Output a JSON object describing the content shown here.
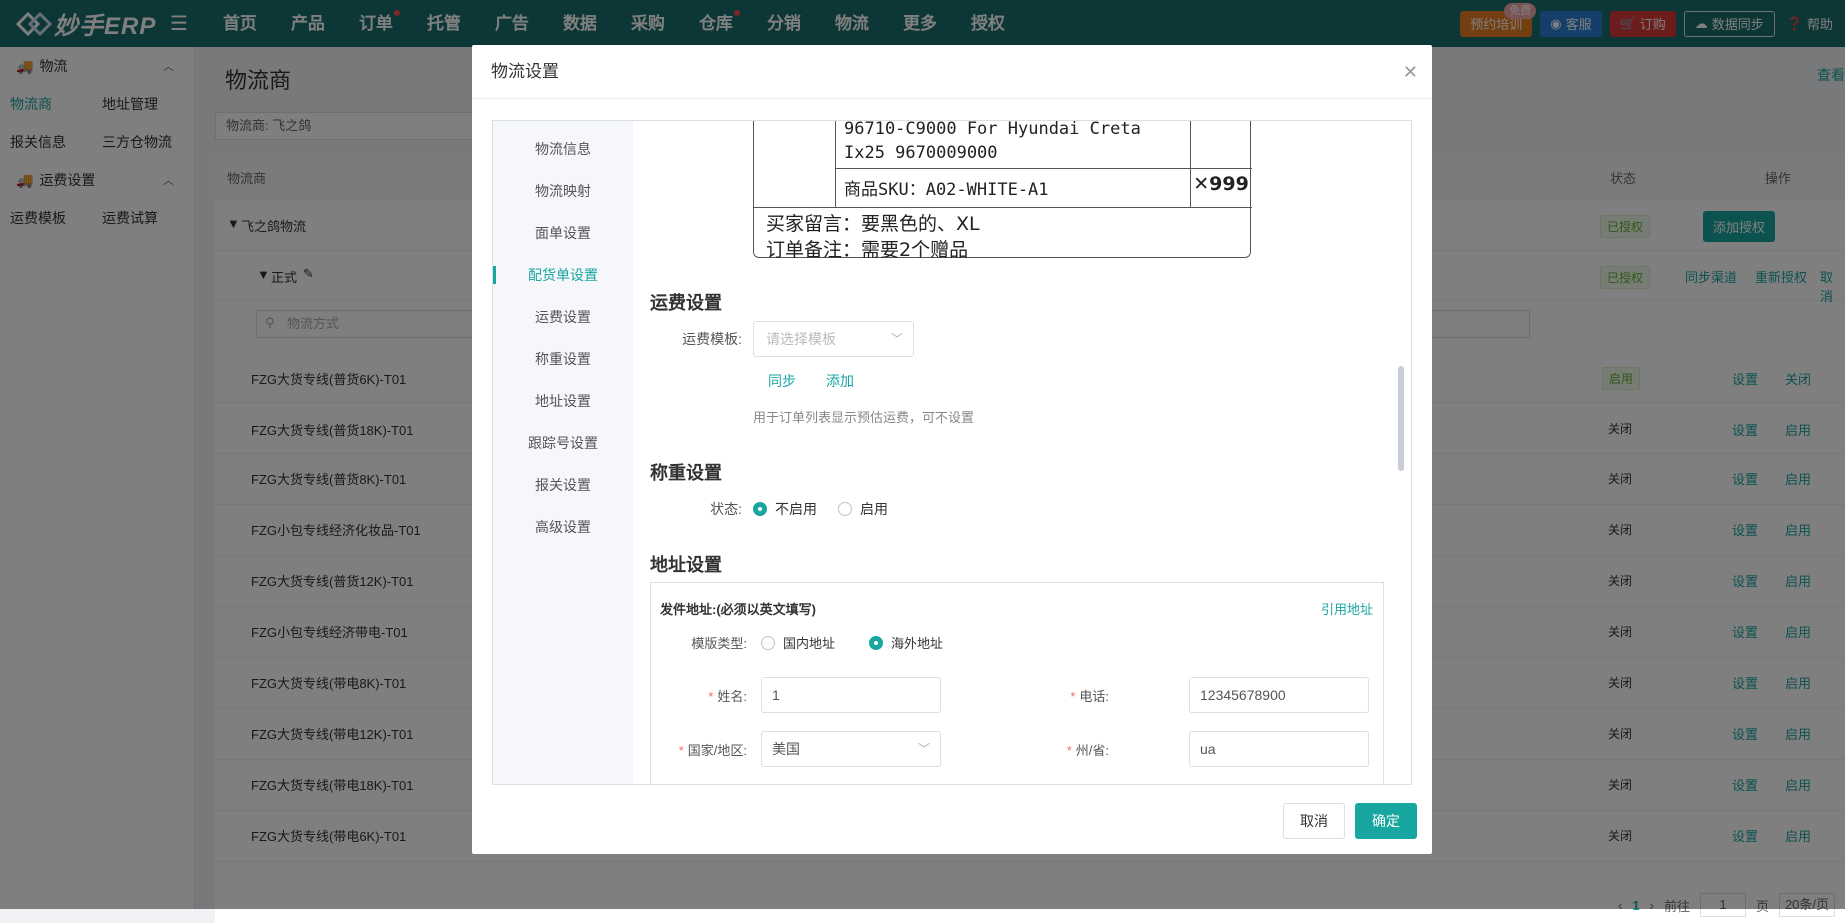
{
  "topbar": {
    "logo_text": "妙手ERP",
    "nav": [
      {
        "label": "首页",
        "dot": false
      },
      {
        "label": "产品",
        "dot": false
      },
      {
        "label": "订单",
        "dot": true
      },
      {
        "label": "托管",
        "dot": false
      },
      {
        "label": "广告",
        "dot": false
      },
      {
        "label": "数据",
        "dot": false
      },
      {
        "label": "采购",
        "dot": false
      },
      {
        "label": "仓库",
        "dot": true
      },
      {
        "label": "分销",
        "dot": false
      },
      {
        "label": "物流",
        "dot": false
      },
      {
        "label": "更多",
        "dot": false
      },
      {
        "label": "授权",
        "dot": false
      }
    ],
    "training": "预约培训",
    "free_badge": "免费",
    "service": "客服",
    "subscribe": "订购",
    "data_sync": "数据同步",
    "help": "帮助"
  },
  "sidebar": {
    "group1": "物流",
    "group1_items": [
      "物流商",
      "地址管理",
      "报关信息",
      "三方仓物流"
    ],
    "group2": "运费设置",
    "group2_items": [
      "运费模板",
      "运费试算"
    ]
  },
  "main": {
    "title": "物流商",
    "view_link": "查看",
    "filter": "物流商: 飞之鸽",
    "columns": {
      "provider": "物流商",
      "status": "状态",
      "action": "操作"
    },
    "provider_row": {
      "name": "飞之鸽物流",
      "status": "已授权",
      "add_auth": "添加授权"
    },
    "account_row": {
      "name": "正式",
      "status": "已授权",
      "sync": "同步渠道",
      "reauth": "重新授权",
      "cancel": "取消"
    },
    "search_placeholder": "物流方式",
    "rows": [
      {
        "name": "FZG大货专线(普货6K)-T01",
        "status": "启用",
        "set": "设置",
        "toggle": "关闭"
      },
      {
        "name": "FZG大货专线(普货18K)-T01",
        "status": "关闭",
        "set": "设置",
        "toggle": "启用"
      },
      {
        "name": "FZG大货专线(普货8K)-T01",
        "status": "关闭",
        "set": "设置",
        "toggle": "启用"
      },
      {
        "name": "FZG小包专线经济化妆品-T01",
        "status": "关闭",
        "set": "设置",
        "toggle": "启用"
      },
      {
        "name": "FZG大货专线(普货12K)-T01",
        "status": "关闭",
        "set": "设置",
        "toggle": "启用"
      },
      {
        "name": "FZG小包专线经济带电-T01",
        "status": "关闭",
        "set": "设置",
        "toggle": "启用"
      },
      {
        "name": "FZG大货专线(带电8K)-T01",
        "status": "关闭",
        "set": "设置",
        "toggle": "启用"
      },
      {
        "name": "FZG大货专线(带电12K)-T01",
        "status": "关闭",
        "set": "设置",
        "toggle": "启用"
      },
      {
        "name": "FZG大货专线(带电18K)-T01",
        "status": "关闭",
        "set": "设置",
        "toggle": "启用"
      },
      {
        "name": "FZG大货专线(带电6K)-T01",
        "status": "关闭",
        "set": "设置",
        "toggle": "启用"
      }
    ],
    "pager": {
      "page": "1",
      "goto": "前往",
      "page_input": "1",
      "page_unit": "页",
      "size": "20条/页"
    }
  },
  "modal": {
    "title": "物流设置",
    "nav": [
      "物流信息",
      "物流映射",
      "面单设置",
      "配货单设置",
      "运费设置",
      "称重设置",
      "地址设置",
      "跟踪号设置",
      "报关设置",
      "高级设置"
    ],
    "active_nav": 3,
    "preview": {
      "line1": "96710-C9000 For Hyundai Creta",
      "line2": "Ix25 9670009000",
      "sku": "商品SKU：A02-WHITE-A1",
      "qty": "✕999",
      "buyer_note": "买家留言：要黑色的、XL",
      "order_note": "订单备注：需要2个赠品"
    },
    "freight": {
      "title": "运费设置",
      "label": "运费模板:",
      "placeholder": "请选择模板",
      "sync": "同步",
      "add": "添加",
      "hint": "用于订单列表显示预估运费，可不设置"
    },
    "weigh": {
      "title": "称重设置",
      "label": "状态:",
      "opt_off": "不启用",
      "opt_on": "启用"
    },
    "address": {
      "title": "地址设置",
      "sender_label": "发件地址:(必须以英文填写)",
      "quote": "引用地址",
      "type_label": "模版类型:",
      "opt_domestic": "国内地址",
      "opt_overseas": "海外地址",
      "name_label": "姓名:",
      "name_value": "1",
      "phone_label": "电话:",
      "phone_value": "12345678900",
      "country_label": "国家/地区:",
      "country_value": "美国",
      "state_label": "州/省:",
      "state_value": "ua"
    },
    "cancel": "取消",
    "confirm": "确定"
  }
}
